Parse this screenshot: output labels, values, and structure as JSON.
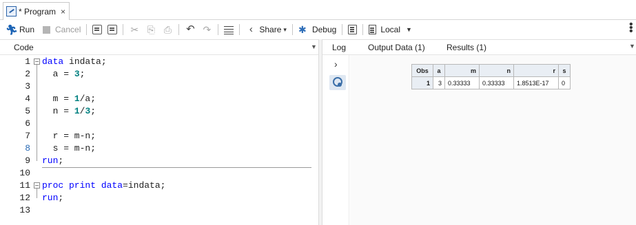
{
  "tab": {
    "title": "* Program",
    "close": "×",
    "icon": "sas-program-icon"
  },
  "toolbar": {
    "run": "Run",
    "cancel": "Cancel",
    "share": "Share",
    "debug": "Debug",
    "server": "Local"
  },
  "left_panel": {
    "title": "Code"
  },
  "editor": {
    "lines": [
      {
        "n": "1",
        "text": "data indata;"
      },
      {
        "n": "2",
        "text": "  a = 3;"
      },
      {
        "n": "3",
        "text": ""
      },
      {
        "n": "4",
        "text": "  m = 1/a;"
      },
      {
        "n": "5",
        "text": "  n = 1/3;"
      },
      {
        "n": "6",
        "text": ""
      },
      {
        "n": "7",
        "text": "  r = m-n;"
      },
      {
        "n": "8",
        "text": "  s = m-n;"
      },
      {
        "n": "9",
        "text": "run;"
      },
      {
        "n": "10",
        "text": ""
      },
      {
        "n": "11",
        "text": "proc print data=indata;"
      },
      {
        "n": "12",
        "text": "run;"
      },
      {
        "n": "13",
        "text": ""
      }
    ]
  },
  "right_tabs": [
    "Log",
    "Output Data (1)",
    "Results (1)"
  ],
  "results_table": {
    "headers": [
      "Obs",
      "a",
      "m",
      "n",
      "r",
      "s"
    ],
    "rows": [
      [
        "1",
        "3",
        "0.33333",
        "0.33333",
        "1.8513E-17",
        "0"
      ]
    ]
  },
  "colors": {
    "keyword": "#0000ff",
    "number": "#008080",
    "accent": "#1d64b5"
  }
}
